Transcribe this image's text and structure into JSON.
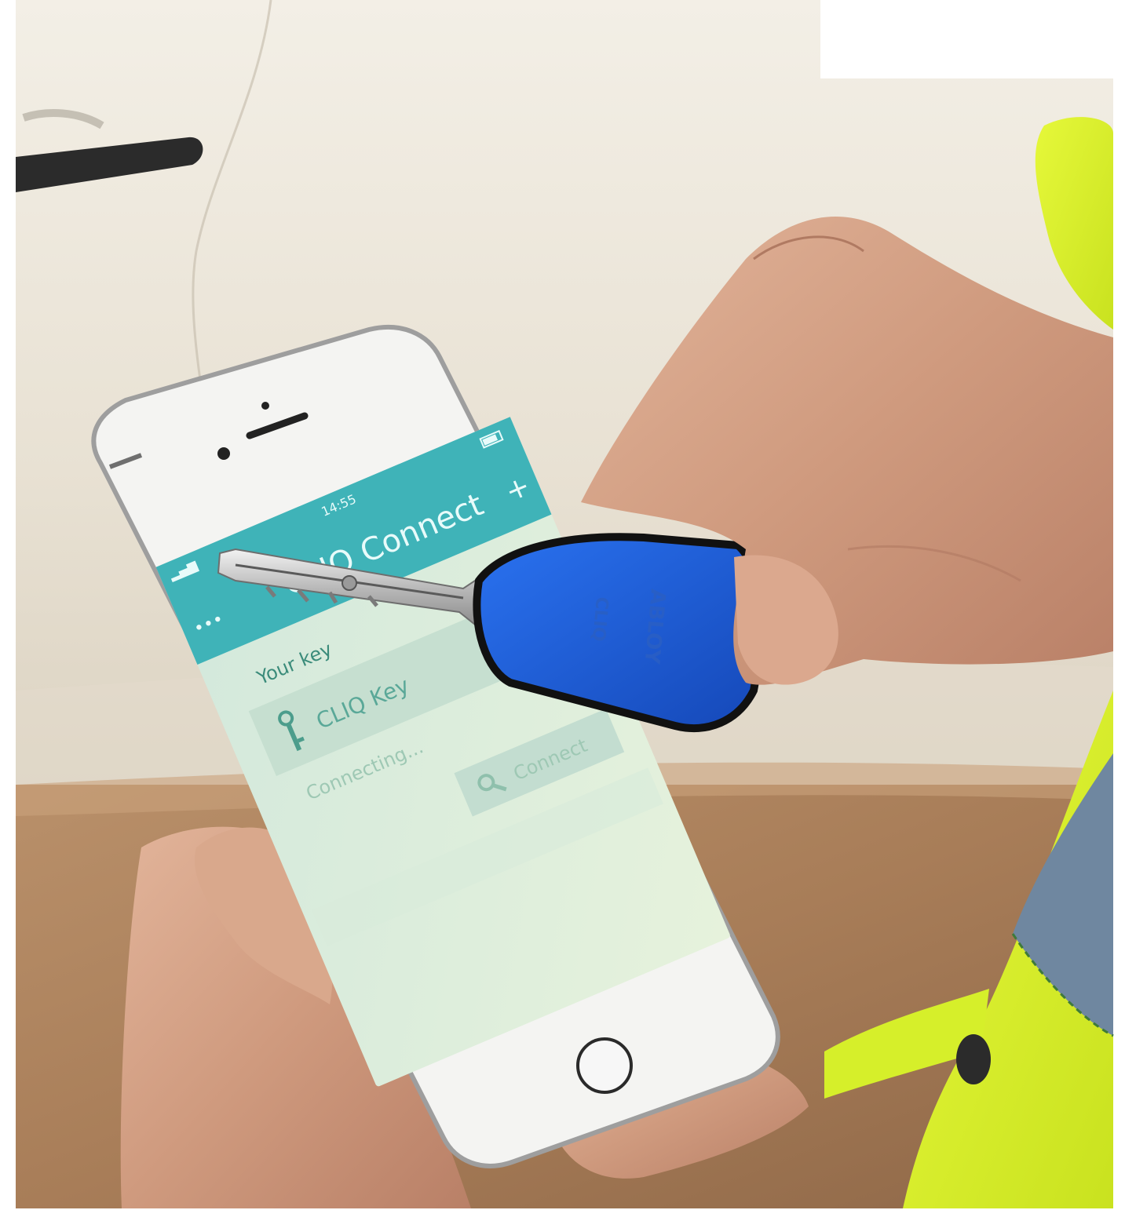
{
  "app": {
    "title": "CLIQ Connect",
    "status_time": "14:55",
    "menu_glyph": "•••",
    "add_glyph": "+"
  },
  "key_section": {
    "heading": "Your key",
    "key_name": "CLIQ Key",
    "status": "Connecting...",
    "connect_label": "Connect"
  },
  "physical_key": {
    "brand_text": "ABLOY",
    "model_text": "CLIQ"
  },
  "icons": [
    "key-icon",
    "search-key-icon",
    "menu-dots-icon",
    "plus-icon",
    "battery-icon",
    "signal-icon"
  ],
  "colors": {
    "app_header": "#3fb3b8",
    "screen_bg": "#dfeede",
    "key_fob": "#1f5fe0",
    "vest": "#d8f02a",
    "car": "#ece7dc"
  }
}
